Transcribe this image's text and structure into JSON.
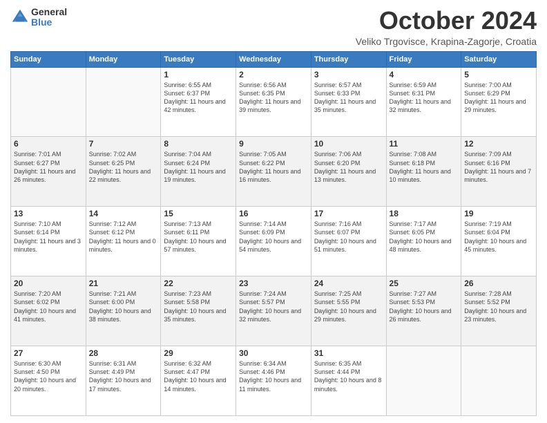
{
  "logo": {
    "general": "General",
    "blue": "Blue"
  },
  "header": {
    "title": "October 2024",
    "location": "Veliko Trgovisce, Krapina-Zagorje, Croatia"
  },
  "weekdays": [
    "Sunday",
    "Monday",
    "Tuesday",
    "Wednesday",
    "Thursday",
    "Friday",
    "Saturday"
  ],
  "days": [
    {
      "num": "",
      "info": ""
    },
    {
      "num": "",
      "info": ""
    },
    {
      "num": "1",
      "info": "Sunrise: 6:55 AM\nSunset: 6:37 PM\nDaylight: 11 hours and 42 minutes."
    },
    {
      "num": "2",
      "info": "Sunrise: 6:56 AM\nSunset: 6:35 PM\nDaylight: 11 hours and 39 minutes."
    },
    {
      "num": "3",
      "info": "Sunrise: 6:57 AM\nSunset: 6:33 PM\nDaylight: 11 hours and 35 minutes."
    },
    {
      "num": "4",
      "info": "Sunrise: 6:59 AM\nSunset: 6:31 PM\nDaylight: 11 hours and 32 minutes."
    },
    {
      "num": "5",
      "info": "Sunrise: 7:00 AM\nSunset: 6:29 PM\nDaylight: 11 hours and 29 minutes."
    },
    {
      "num": "6",
      "info": "Sunrise: 7:01 AM\nSunset: 6:27 PM\nDaylight: 11 hours and 26 minutes."
    },
    {
      "num": "7",
      "info": "Sunrise: 7:02 AM\nSunset: 6:25 PM\nDaylight: 11 hours and 22 minutes."
    },
    {
      "num": "8",
      "info": "Sunrise: 7:04 AM\nSunset: 6:24 PM\nDaylight: 11 hours and 19 minutes."
    },
    {
      "num": "9",
      "info": "Sunrise: 7:05 AM\nSunset: 6:22 PM\nDaylight: 11 hours and 16 minutes."
    },
    {
      "num": "10",
      "info": "Sunrise: 7:06 AM\nSunset: 6:20 PM\nDaylight: 11 hours and 13 minutes."
    },
    {
      "num": "11",
      "info": "Sunrise: 7:08 AM\nSunset: 6:18 PM\nDaylight: 11 hours and 10 minutes."
    },
    {
      "num": "12",
      "info": "Sunrise: 7:09 AM\nSunset: 6:16 PM\nDaylight: 11 hours and 7 minutes."
    },
    {
      "num": "13",
      "info": "Sunrise: 7:10 AM\nSunset: 6:14 PM\nDaylight: 11 hours and 3 minutes."
    },
    {
      "num": "14",
      "info": "Sunrise: 7:12 AM\nSunset: 6:12 PM\nDaylight: 11 hours and 0 minutes."
    },
    {
      "num": "15",
      "info": "Sunrise: 7:13 AM\nSunset: 6:11 PM\nDaylight: 10 hours and 57 minutes."
    },
    {
      "num": "16",
      "info": "Sunrise: 7:14 AM\nSunset: 6:09 PM\nDaylight: 10 hours and 54 minutes."
    },
    {
      "num": "17",
      "info": "Sunrise: 7:16 AM\nSunset: 6:07 PM\nDaylight: 10 hours and 51 minutes."
    },
    {
      "num": "18",
      "info": "Sunrise: 7:17 AM\nSunset: 6:05 PM\nDaylight: 10 hours and 48 minutes."
    },
    {
      "num": "19",
      "info": "Sunrise: 7:19 AM\nSunset: 6:04 PM\nDaylight: 10 hours and 45 minutes."
    },
    {
      "num": "20",
      "info": "Sunrise: 7:20 AM\nSunset: 6:02 PM\nDaylight: 10 hours and 41 minutes."
    },
    {
      "num": "21",
      "info": "Sunrise: 7:21 AM\nSunset: 6:00 PM\nDaylight: 10 hours and 38 minutes."
    },
    {
      "num": "22",
      "info": "Sunrise: 7:23 AM\nSunset: 5:58 PM\nDaylight: 10 hours and 35 minutes."
    },
    {
      "num": "23",
      "info": "Sunrise: 7:24 AM\nSunset: 5:57 PM\nDaylight: 10 hours and 32 minutes."
    },
    {
      "num": "24",
      "info": "Sunrise: 7:25 AM\nSunset: 5:55 PM\nDaylight: 10 hours and 29 minutes."
    },
    {
      "num": "25",
      "info": "Sunrise: 7:27 AM\nSunset: 5:53 PM\nDaylight: 10 hours and 26 minutes."
    },
    {
      "num": "26",
      "info": "Sunrise: 7:28 AM\nSunset: 5:52 PM\nDaylight: 10 hours and 23 minutes."
    },
    {
      "num": "27",
      "info": "Sunrise: 6:30 AM\nSunset: 4:50 PM\nDaylight: 10 hours and 20 minutes."
    },
    {
      "num": "28",
      "info": "Sunrise: 6:31 AM\nSunset: 4:49 PM\nDaylight: 10 hours and 17 minutes."
    },
    {
      "num": "29",
      "info": "Sunrise: 6:32 AM\nSunset: 4:47 PM\nDaylight: 10 hours and 14 minutes."
    },
    {
      "num": "30",
      "info": "Sunrise: 6:34 AM\nSunset: 4:46 PM\nDaylight: 10 hours and 11 minutes."
    },
    {
      "num": "31",
      "info": "Sunrise: 6:35 AM\nSunset: 4:44 PM\nDaylight: 10 hours and 8 minutes."
    },
    {
      "num": "",
      "info": ""
    },
    {
      "num": "",
      "info": ""
    }
  ]
}
